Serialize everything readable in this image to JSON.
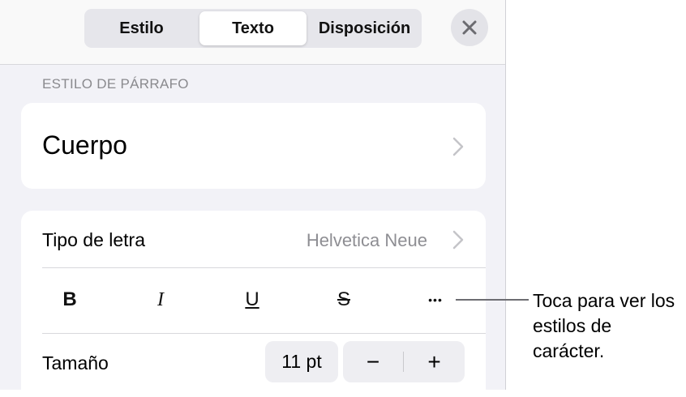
{
  "tabs": [
    {
      "label": "Estilo",
      "selected": false
    },
    {
      "label": "Texto",
      "selected": true
    },
    {
      "label": "Disposición",
      "selected": false
    }
  ],
  "section_label": "ESTILO DE PÁRRAFO",
  "paragraph_style": "Cuerpo",
  "font": {
    "label": "Tipo de letra",
    "value": "Helvetica Neue"
  },
  "format_buttons": {
    "bold": "B",
    "italic": "I",
    "underline": "U",
    "strikethrough": "S",
    "more": "•••"
  },
  "size": {
    "label": "Tamaño",
    "value": "11 pt",
    "decrease": "−",
    "increase": "+"
  },
  "callout": {
    "text": "Toca para ver los estilos de carácter."
  },
  "icons": {
    "close": "close-icon",
    "chevron": "chevron-right-icon"
  },
  "colors": {
    "panel_bg": "#f2f2f7",
    "card_bg": "#ffffff",
    "secondary_text": "#8e8e93"
  }
}
